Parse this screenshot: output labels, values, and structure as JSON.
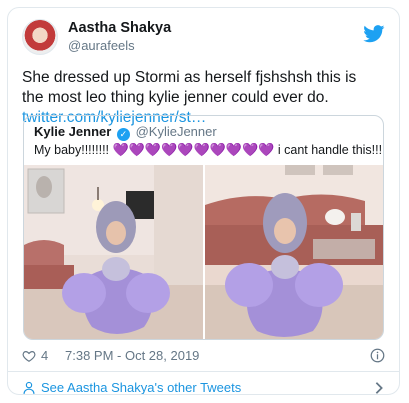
{
  "author": {
    "name": "Aastha Shakya",
    "handle": "@aurafeels"
  },
  "tweet": {
    "text": "She dressed up Stormi as herself fjshshsh this is the most leo thing kylie jenner could ever do.",
    "link": "twitter.com/kyliejenner/st…"
  },
  "quoted": {
    "name": "Kylie Jenner",
    "handle": "@KylieJenner",
    "text_start": "My baby!!!!!!!!",
    "hearts": "💜💜💜💜💜💜💜💜💜💜",
    "text_end": "i cant handle this!!!!"
  },
  "footer": {
    "likes": "4",
    "timestamp": "7:38 PM - Oct 28, 2019"
  },
  "more_link": "See Aastha Shakya's other Tweets",
  "colors": {
    "link": "#1b95e0",
    "brand": "#1da1f2",
    "muted": "#657786",
    "border": "#e1e8ed"
  },
  "icons": [
    "twitter-bird-icon",
    "verified-badge-icon",
    "heart-outline-icon",
    "info-icon",
    "person-icon",
    "chevron-right-icon"
  ]
}
